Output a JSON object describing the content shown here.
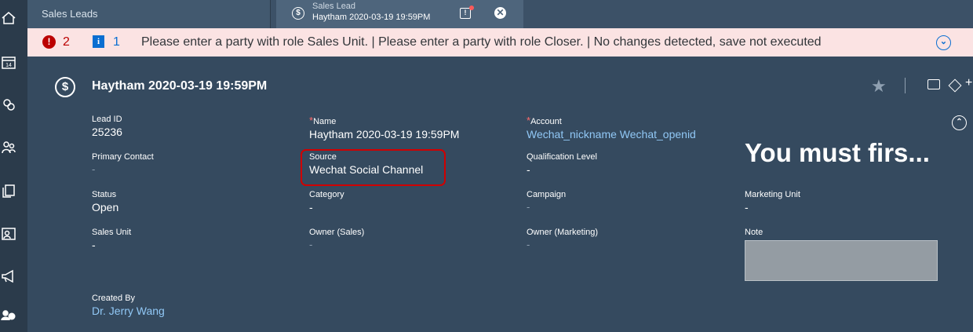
{
  "rail": {
    "icons": [
      "home-icon",
      "calendar-icon",
      "settings-group-icon",
      "people-icon",
      "copy-icon",
      "people-card-icon",
      "megaphone-icon",
      "person-dollar-icon"
    ],
    "calendar_day": "14"
  },
  "tabs": {
    "list_tab": "Sales Leads",
    "detail_tab_title": "Sales Lead",
    "detail_tab_subtitle": "Haytham 2020-03-19 19:59PM",
    "detail_icon": "$",
    "msg_icon": "!",
    "close_icon": "✕"
  },
  "messages": {
    "error_icon": "!",
    "error_count": "2",
    "info_icon": "i",
    "info_count": "1",
    "text": "Please enter a party with role Sales Unit. | Please enter a party with role Closer. | No changes detected, save not executed",
    "collapse_icon": "⌄"
  },
  "header": {
    "icon": "$",
    "title": "Haytham 2020-03-19 19:59PM",
    "star": "★",
    "more": "+",
    "expand_icon": "⌃"
  },
  "fields": {
    "lead_id": {
      "label": "Lead ID",
      "value": "25236"
    },
    "name": {
      "label": "Name",
      "value": "Haytham 2020-03-19 19:59PM",
      "required": "*"
    },
    "account": {
      "label": "Account",
      "value": "Wechat_nickname Wechat_openid",
      "required": "*"
    },
    "primary_contact": {
      "label": "Primary Contact",
      "value": "-"
    },
    "source": {
      "label": "Source",
      "value": "Wechat Social Channel"
    },
    "qualification_level": {
      "label": "Qualification Level",
      "value": "-"
    },
    "status": {
      "label": "Status",
      "value": "Open"
    },
    "category": {
      "label": "Category",
      "value": "-"
    },
    "campaign": {
      "label": "Campaign",
      "value": "-"
    },
    "marketing_unit": {
      "label": "Marketing Unit",
      "value": "-"
    },
    "sales_unit": {
      "label": "Sales Unit",
      "value": "-"
    },
    "owner_sales": {
      "label": "Owner (Sales)",
      "value": "-"
    },
    "owner_marketing": {
      "label": "Owner (Marketing)",
      "value": "-"
    },
    "note": {
      "label": "Note"
    },
    "created_by": {
      "label": "Created By",
      "value": "Dr. Jerry Wang"
    }
  },
  "banner": "You must firs...",
  "colors": {
    "error": "#bb0000",
    "info": "#0a6ed1",
    "highlight": "#d00000",
    "link": "#91c8f6"
  }
}
